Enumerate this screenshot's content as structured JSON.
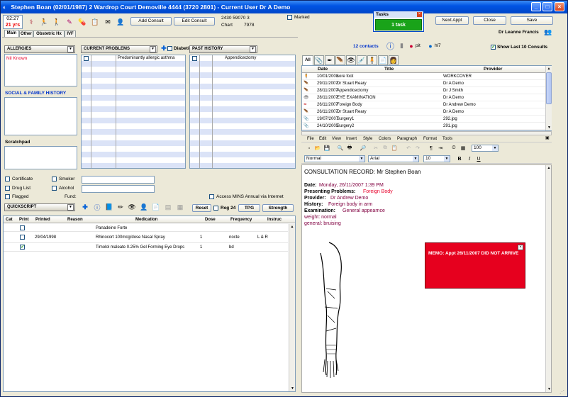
{
  "window": {
    "title": "Stephen Boan (02/01/1987) 2 Wardrop Court Demoville 4444 (3720 2801) - Current User Dr A Demo"
  },
  "clock": {
    "time": "02:27",
    "age": "21 yrs"
  },
  "toolbar": {
    "add_consult": "Add Consult",
    "edit_consult": "Edit Consult",
    "patient_number": "2430 59070 3",
    "chart_label": "Chart",
    "chart_number": "7978",
    "marked_label": "Marked",
    "next_appt": "Next Appt",
    "close": "Close",
    "save": "Save",
    "doctor": "Dr Leanne Francis"
  },
  "tasks": {
    "title": "Tasks",
    "button": "1 task"
  },
  "left_tabs": [
    "Main",
    "Other",
    "Obstetric Hx",
    "IVF"
  ],
  "allergies": {
    "label": "ALLERGIES",
    "value": "Nil Known"
  },
  "current_problems": {
    "label": "CURRENT PROBLEMS",
    "diabetic": "Diabetic",
    "items": [
      "Predominantly allergic asthma"
    ]
  },
  "past_history": {
    "label": "PAST HISTORY",
    "items": [
      "Appendicectomy"
    ]
  },
  "social_history": {
    "label": "SOCIAL & FAMILY HISTORY"
  },
  "scratchpad": {
    "label": "Scratchpad"
  },
  "flags": {
    "certificate": "Certificate",
    "drug_list": "Drug List",
    "flagged": "Flagged",
    "smoker": "Smoker",
    "alcohol": "Alcohol",
    "fund": "Fund:",
    "access_mins": "Access MINS Annual via Internet"
  },
  "quickscript": {
    "label": "QUICKSCRIPT",
    "reset": "Reset",
    "reg24": "Reg 24",
    "tpg": "TPG",
    "strength": "Strength"
  },
  "medications": {
    "columns": [
      "Cat",
      "Print",
      "Printed",
      "Reason",
      "Medication",
      "Dose",
      "Frequency",
      "Instruc"
    ],
    "rows": [
      {
        "printed": "",
        "reason": "",
        "medication": "Panadeine Forte",
        "dose": "",
        "frequency": "",
        "instruc": "",
        "checked": false
      },
      {
        "printed": "29/04/1998",
        "reason": "",
        "medication": "Rhinocort 100mcg/dose Nasal Spray",
        "dose": "1",
        "frequency": "nocte",
        "instruc": "L & R",
        "checked": false
      },
      {
        "printed": "",
        "reason": "",
        "medication": "Timolol maleate 0.25% Gel Forming Eye Drops",
        "dose": "1",
        "frequency": "bd",
        "instruc": "",
        "checked": true
      }
    ]
  },
  "contacts": {
    "count": "12 contacts",
    "pit_label": "pit",
    "hl7_label": "hl7",
    "show_last": "Show Last 10 Consults",
    "all_tab": "All"
  },
  "consults": {
    "columns": [
      "Date",
      "Title",
      "Provider"
    ],
    "rows": [
      {
        "date": "10/01/2008",
        "title": "sore foot",
        "provider": "WORKCOVER"
      },
      {
        "date": "29/11/2007",
        "title": "Dr Stuart Reary",
        "provider": "Dr A Demo"
      },
      {
        "date": "28/11/2007",
        "title": "Appendicectomy",
        "provider": "Dr J Smith"
      },
      {
        "date": "28/11/2007",
        "title": "EYE EXAMINATION",
        "provider": "Dr A Demo"
      },
      {
        "date": "26/11/2007",
        "title": "Foreign Body",
        "provider": "Dr Andrew Demo"
      },
      {
        "date": "26/11/2007",
        "title": "Dr Stuart Reary",
        "provider": "Dr A Demo"
      },
      {
        "date": "19/07/2007",
        "title": "Surgery1",
        "provider": "292.jpg"
      },
      {
        "date": "24/10/2005",
        "title": "Surgery2",
        "provider": "291.jpg"
      }
    ]
  },
  "editor": {
    "menu": [
      "File",
      "Edit",
      "View",
      "Insert",
      "Style",
      "Colors",
      "Paragraph",
      "Format",
      "Tools"
    ],
    "zoom": "100",
    "style": "Normal",
    "font": "Arial",
    "size": "10"
  },
  "record": {
    "heading": "CONSULTATION RECORD: Mr Stephen Boan",
    "date_label": "Date:",
    "date_value": "Monday, 26/11/2007  1:39 PM",
    "problems_label": "Presenting Problems:",
    "problems_value": "Foreign Body",
    "provider_label": "Provider:",
    "provider_value": "Dr Andrew Demo",
    "history_label": "History:",
    "history_value": "Foreign body in arm",
    "exam_label": "Examination:",
    "exam_value": "General appearnce",
    "weight": "weight: normal",
    "general": "general: bruising"
  },
  "memo": {
    "text": "MEMO: Appt 26/11/2007 DID NOT ARRIVE"
  },
  "colors": {
    "titlebar": "#0054e3",
    "tasks_green": "#19a319",
    "memo_red": "#e6001e",
    "maroon_text": "#800040",
    "red_text": "#e8002a",
    "link_blue": "#0033cc"
  }
}
